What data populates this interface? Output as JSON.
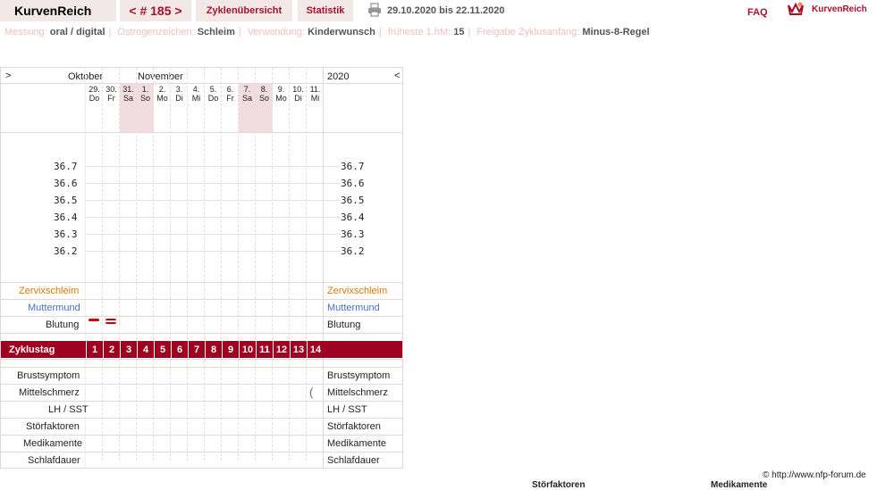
{
  "header": {
    "brand": "KurvenReich",
    "cycle_nav": "< # 185 >",
    "tab_cycles": "Zyklenübersicht",
    "tab_stats": "Statistik",
    "date_range": "29.10.2020 bis 22.11.2020",
    "faq": "FAQ",
    "logo_text": "KurvenReich"
  },
  "info": {
    "messung_label": "Messung:",
    "messung_value": "oral / digital",
    "oestrogen_label": "Östrogenzeichen:",
    "oestrogen_value": "Schleim",
    "verwendung_label": "Verwendung:",
    "verwendung_value": "Kinderwunsch",
    "fhm_label": "früheste 1.hM:",
    "fhm_value": "15",
    "freigabe_label": "Freigabe Zyklusanfang:",
    "freigabe_value": "Minus-8-Regel"
  },
  "chart": {
    "nav_prev": ">",
    "month1": "Oktober",
    "month2": "November",
    "year": "2020",
    "nav_next": "<",
    "dates": [
      "29.",
      "30.",
      "31.",
      "1.",
      "2.",
      "3.",
      "4.",
      "5.",
      "6.",
      "7.",
      "8.",
      "9.",
      "10.",
      "11."
    ],
    "weekdays": [
      "Do",
      "Fr",
      "Sa",
      "So",
      "Mo",
      "Di",
      "Mi",
      "Do",
      "Fr",
      "Sa",
      "So",
      "Mo",
      "Di",
      "Mi"
    ],
    "weekend_indices": [
      2,
      3,
      9,
      10
    ],
    "temps": [
      "36.7",
      "36.6",
      "36.5",
      "36.4",
      "36.3",
      "36.2"
    ],
    "rows": {
      "zervix": "Zervixschleim",
      "muttermund": "Muttermund",
      "blutung": "Blutung",
      "zyklustag": "Zyklustag",
      "brust": "Brustsymptom",
      "mittel": "Mittelschmerz",
      "lh": "LH / SST",
      "stoer": "Störfaktoren",
      "medi": "Medikamente",
      "schlaf": "Schlafdauer"
    },
    "cycle_days": [
      "1",
      "2",
      "3",
      "4",
      "5",
      "6",
      "7",
      "8",
      "9",
      "10",
      "11",
      "12",
      "13",
      "14"
    ],
    "bleeding": [
      1,
      2
    ],
    "mittelschmerz_day": 14
  },
  "colors": {
    "accent": "#a00020",
    "zervix": "#e07800",
    "muttermund": "#4a6fc4"
  },
  "footer": {
    "credit": "© http://www.nfp-forum.de",
    "cut1": "Störfaktoren",
    "cut2": "Medikamente"
  }
}
